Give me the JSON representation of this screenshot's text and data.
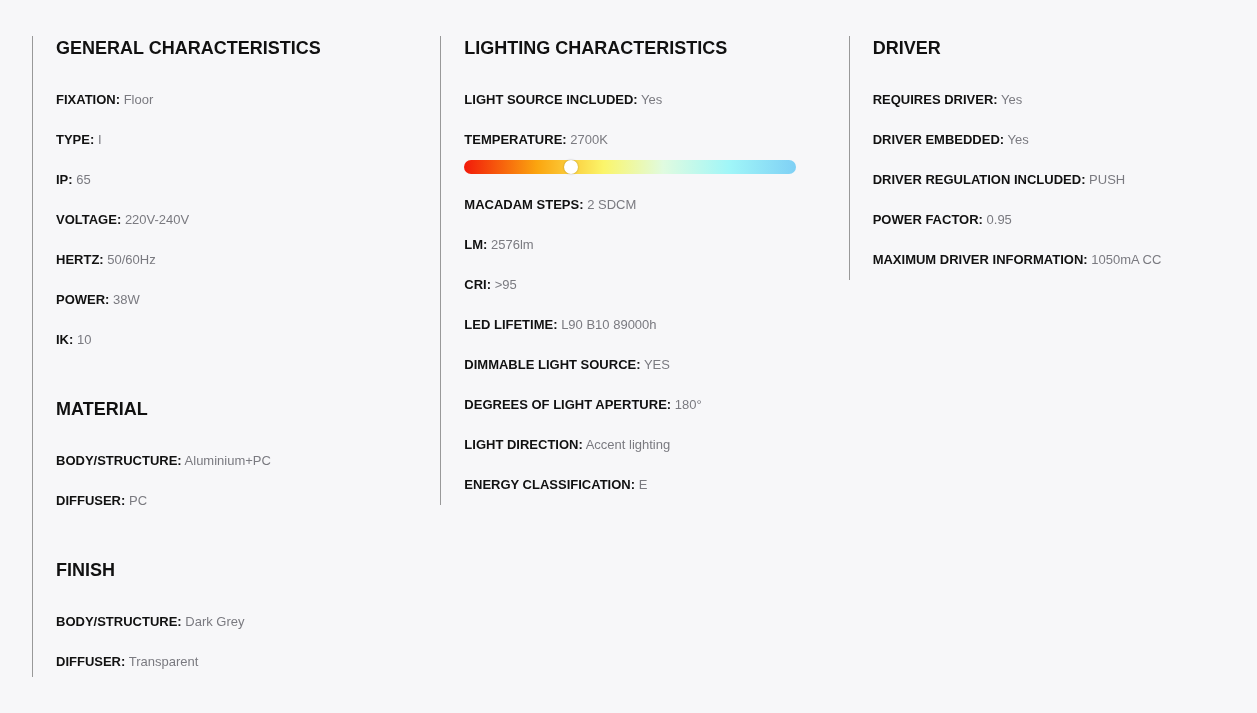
{
  "columns": [
    {
      "sections": [
        {
          "title": "GENERAL CHARACTERISTICS",
          "rows": [
            {
              "kind": "text",
              "label": "FIXATION:",
              "value": "Floor"
            },
            {
              "kind": "text",
              "label": "TYPE:",
              "value": "I"
            },
            {
              "kind": "text",
              "label": "IP:",
              "value": "65"
            },
            {
              "kind": "text",
              "label": "VOLTAGE:",
              "value": "220V-240V"
            },
            {
              "kind": "text",
              "label": "HERTZ:",
              "value": "50/60Hz"
            },
            {
              "kind": "text",
              "label": "POWER:",
              "value": "38W"
            },
            {
              "kind": "text",
              "label": "IK:",
              "value": "10"
            }
          ]
        },
        {
          "title": "MATERIAL",
          "rows": [
            {
              "kind": "text",
              "label": "BODY/STRUCTURE:",
              "value": "Aluminium+PC"
            },
            {
              "kind": "text",
              "label": "DIFFUSER:",
              "value": "PC"
            }
          ]
        },
        {
          "title": "FINISH",
          "rows": [
            {
              "kind": "text",
              "label": "BODY/STRUCTURE:",
              "value": "Dark Grey"
            },
            {
              "kind": "text",
              "label": "DIFFUSER:",
              "value": "Transparent"
            }
          ]
        }
      ]
    },
    {
      "sections": [
        {
          "title": "LIGHTING CHARACTERISTICS",
          "rows": [
            {
              "kind": "text",
              "label": "LIGHT SOURCE INCLUDED:",
              "value": "Yes"
            },
            {
              "kind": "slider",
              "label": "TEMPERATURE:",
              "value": "2700K",
              "level": 0.32
            },
            {
              "kind": "text",
              "label": "MACADAM STEPS:",
              "value": "2 SDCM"
            },
            {
              "kind": "text",
              "label": "LM:",
              "value": "2576lm"
            },
            {
              "kind": "text",
              "label": "CRI:",
              "value": ">95"
            },
            {
              "kind": "text",
              "label": "LED LIFETIME:",
              "value": "L90 B10 89000h"
            },
            {
              "kind": "text",
              "label": "DIMMABLE LIGHT SOURCE:",
              "value": "YES"
            },
            {
              "kind": "text",
              "label": "DEGREES OF LIGHT APERTURE:",
              "value": "180°"
            },
            {
              "kind": "text",
              "label": "LIGHT DIRECTION:",
              "value": "Accent lighting"
            },
            {
              "kind": "text",
              "label": "ENERGY CLASSIFICATION:",
              "value": "E"
            }
          ]
        }
      ]
    },
    {
      "sections": [
        {
          "title": "DRIVER",
          "rows": [
            {
              "kind": "text",
              "label": "REQUIRES DRIVER:",
              "value": "Yes"
            },
            {
              "kind": "text",
              "label": "DRIVER EMBEDDED:",
              "value": "Yes"
            },
            {
              "kind": "text",
              "label": "DRIVER REGULATION INCLUDED:",
              "value": "PUSH"
            },
            {
              "kind": "text",
              "label": "POWER FACTOR:",
              "value": "0.95"
            },
            {
              "kind": "text",
              "label": "MAXIMUM DRIVER INFORMATION:",
              "value": "1050mA CC"
            }
          ]
        }
      ]
    }
  ]
}
